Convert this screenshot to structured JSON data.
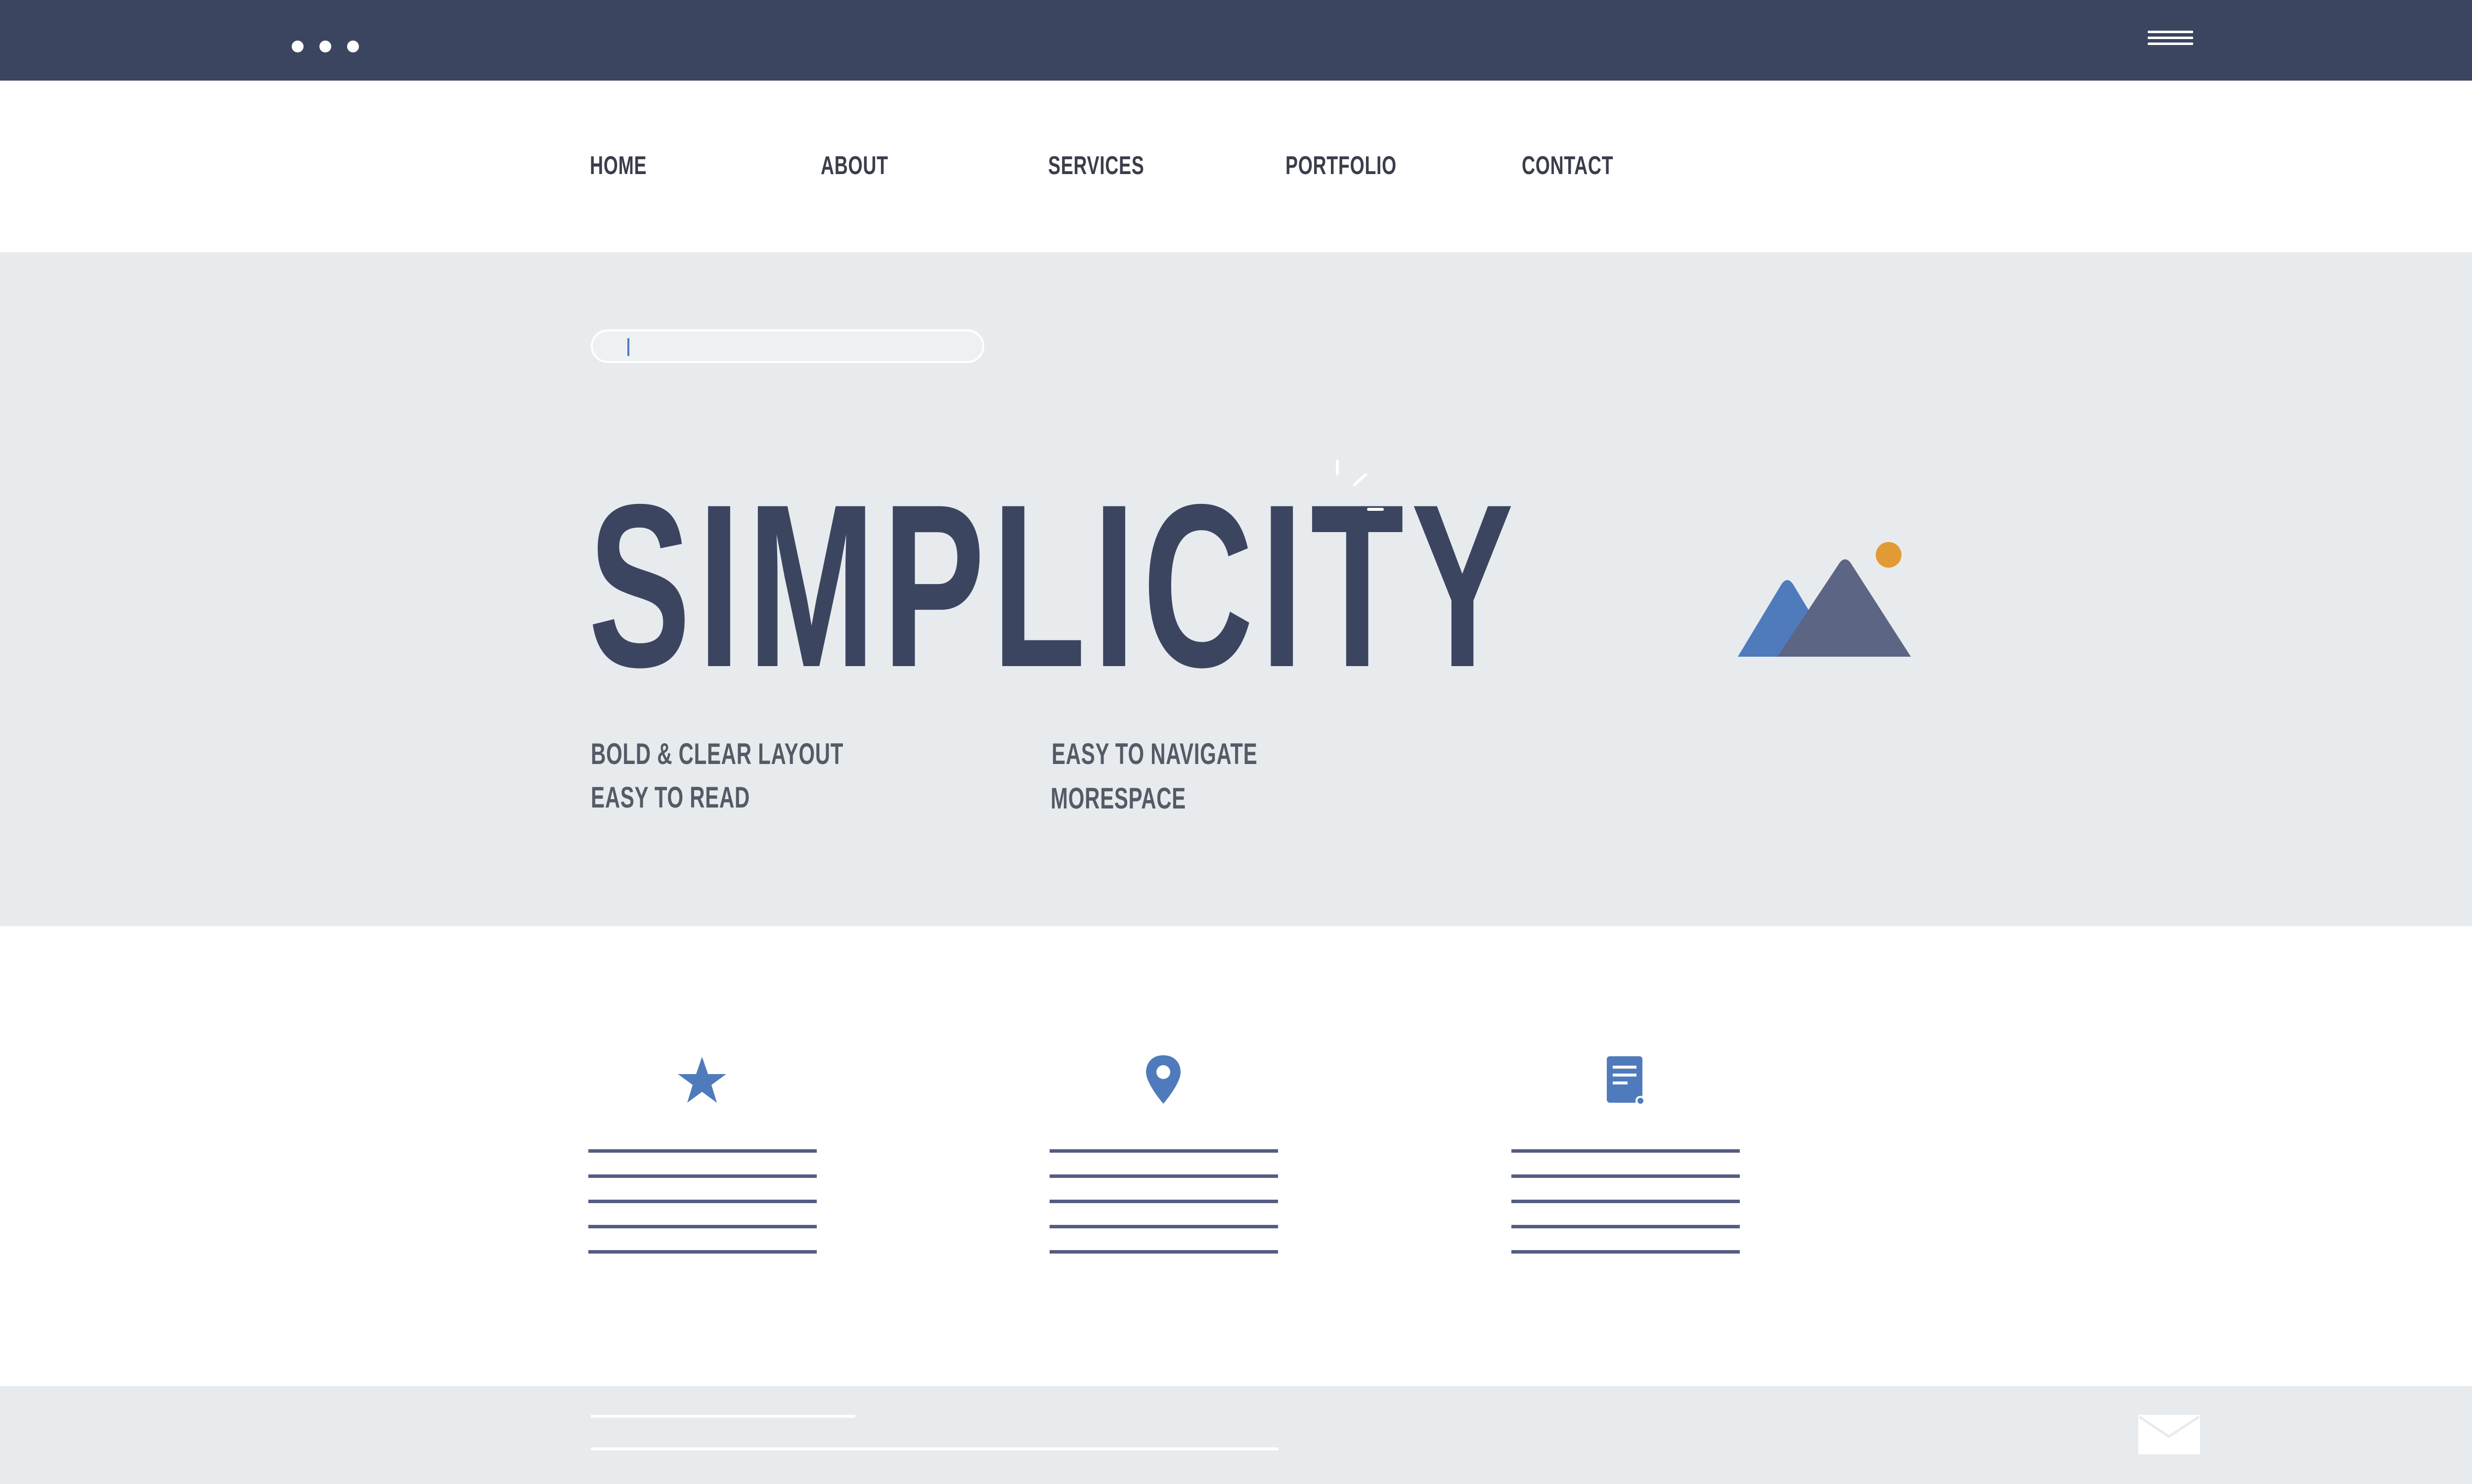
{
  "topbar": {
    "dots_icon": "window-dots-icon",
    "menu_icon": "hamburger-menu-icon",
    "color": "#3c4560"
  },
  "nav": {
    "items": [
      {
        "label": "HOME"
      },
      {
        "label": "ABOUT"
      },
      {
        "label": "SERVICES"
      },
      {
        "label": "PORTFOLIO"
      },
      {
        "label": "CONTACT"
      }
    ]
  },
  "hero": {
    "search_placeholder": "",
    "headline": "SIMPLICITY",
    "features_left": [
      "BOLD & CLEAR LAYOUT",
      "EASY TO READ"
    ],
    "features_right": [
      "EASY TO NAVIGATE",
      "MORESPACE"
    ],
    "image_icon": "mountain-image-icon",
    "background": "#e7ebee"
  },
  "features": {
    "icons": [
      "star-icon",
      "location-pin-icon",
      "document-icon"
    ]
  },
  "footer": {
    "mail_icon": "mail-icon"
  },
  "colors": {
    "primary": "#3c4560",
    "accent_blue": "#4f7bbd",
    "accent_orange": "#e29a35",
    "text": "#3a3d4a"
  }
}
